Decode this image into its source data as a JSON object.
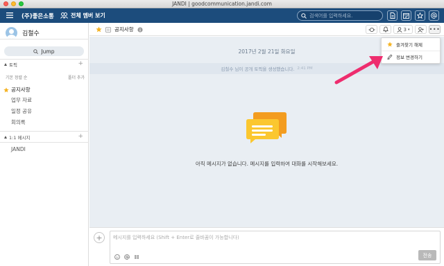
{
  "window": {
    "title": "JANDI | goodcommunication.jandi.com"
  },
  "topbar": {
    "team_name": "(주)좋은소통",
    "all_members_label": "전체 멤버 보기",
    "search_placeholder": "검색어를 입력하세요."
  },
  "sidebar": {
    "user_name": "김철수",
    "jump_label": "Jump",
    "topics_section": "토픽",
    "sort_label": "기본 정렬 순",
    "add_folder_label": "폴더 추가",
    "topics": [
      {
        "label": "공지사항",
        "starred": true
      },
      {
        "label": "업무 자료"
      },
      {
        "label": "일정 공유"
      },
      {
        "label": "회의록"
      }
    ],
    "dm_section": "1:1 메시지",
    "dms": [
      {
        "label": "JANDI"
      }
    ]
  },
  "header": {
    "topic_name": "공지사항",
    "member_count": "3"
  },
  "chat": {
    "date": "2017년 2월 21일 화요일",
    "system_message": "김철수 님이 공개 토픽을 생성했습니다.",
    "system_time": "2:41 PM",
    "empty_message": "아직 메시지가 없습니다. 메시지를 입력하여 대화를 시작해보세요."
  },
  "dropdown": {
    "items": [
      {
        "label": "즐겨찾기 해제",
        "icon": "star-icon"
      },
      {
        "label": "정보 변경하기",
        "icon": "pencil-icon"
      }
    ]
  },
  "composer": {
    "placeholder": "메시지를 입력하세요 (Shift + Enter로 줄바꿈이 가능합니다)",
    "send_label": "전송"
  },
  "colors": {
    "topbar": "#1c4c7c",
    "chat_bg": "#e9eef3",
    "star": "#f5b323",
    "arrow": "#ee2d6e"
  }
}
